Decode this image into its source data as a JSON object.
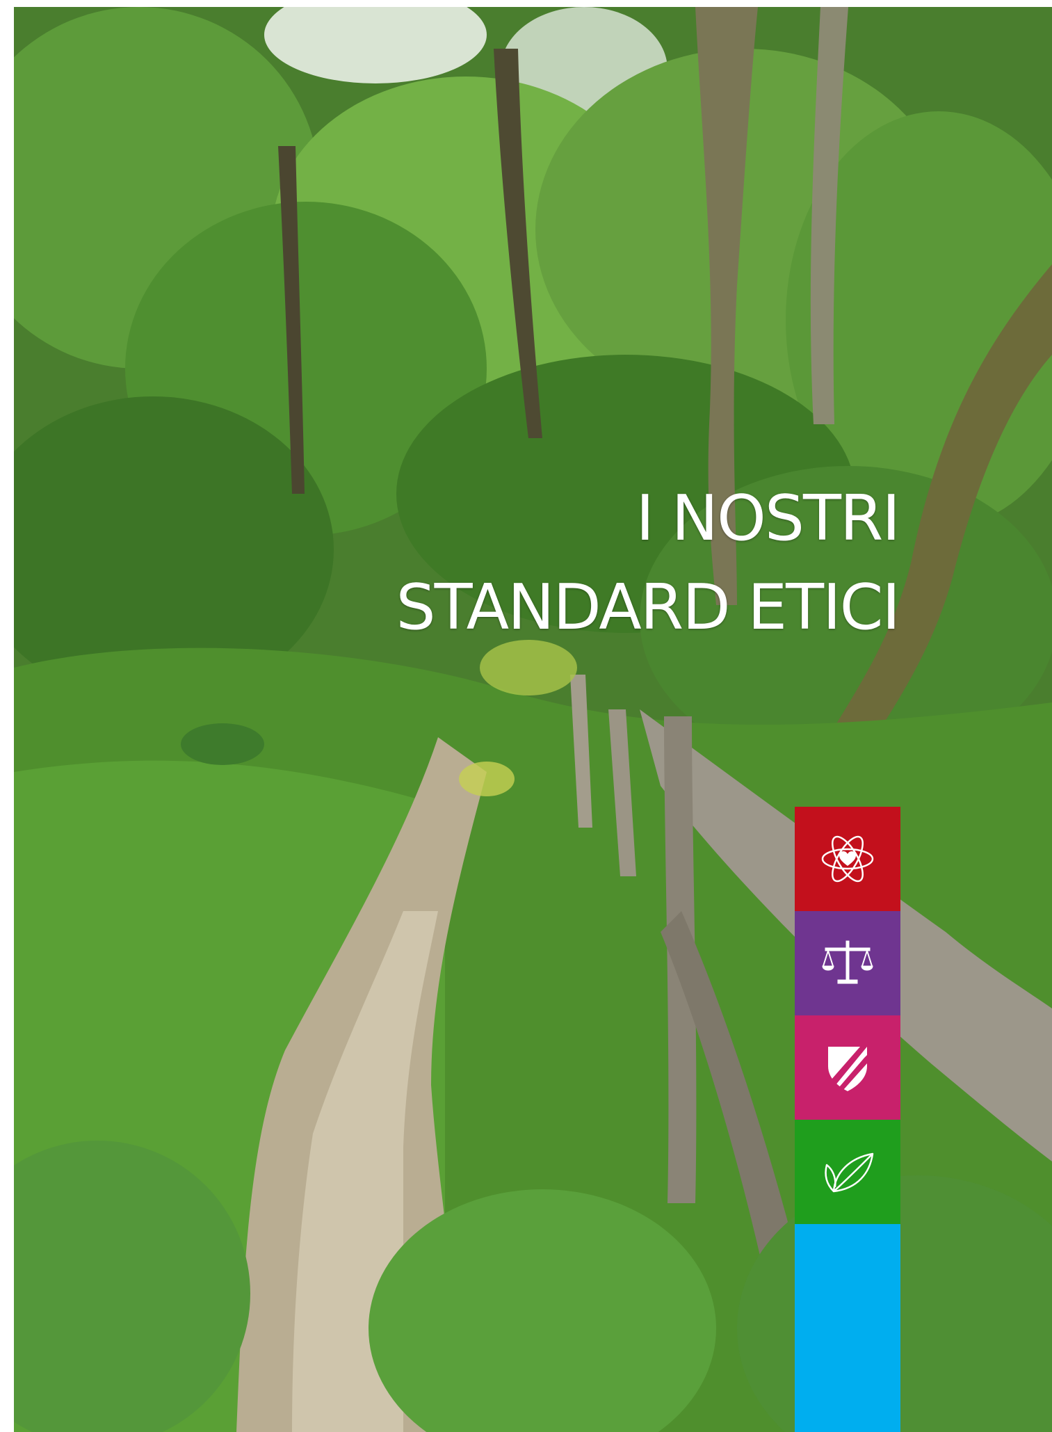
{
  "cover": {
    "title_line_1": "I NOSTRI",
    "title_line_2": "STANDARD ETICI"
  },
  "tiles": [
    {
      "icon": "atom-heart-icon",
      "color": "#c3101c"
    },
    {
      "icon": "balance-scale-icon",
      "color": "#6f3590"
    },
    {
      "icon": "shield-icon",
      "color": "#c8216b"
    },
    {
      "icon": "leaf-icon",
      "color": "#1f9e1d"
    },
    {
      "icon": "",
      "color": "#00aeef"
    }
  ]
}
